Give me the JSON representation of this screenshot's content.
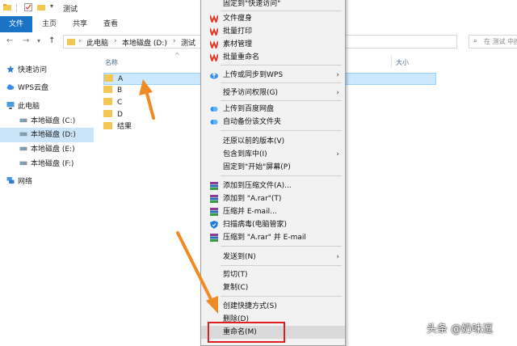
{
  "window": {
    "title": "测试"
  },
  "ribbon": {
    "tabs": [
      {
        "label": "文件"
      },
      {
        "label": "主页"
      },
      {
        "label": "共享"
      },
      {
        "label": "查看"
      }
    ]
  },
  "address": {
    "crumbs": [
      "此电脑",
      "本地磁盘 (D:)",
      "测试"
    ],
    "search_placeholder": "在 测试 中搜索"
  },
  "sidebar": {
    "items": [
      {
        "label": "快速访问",
        "icon": "star-icon"
      },
      {
        "label": "WPS云盘",
        "icon": "cloud-icon"
      },
      {
        "label": "此电脑",
        "icon": "computer-icon"
      },
      {
        "label": "本地磁盘 (C:)",
        "icon": "drive-icon"
      },
      {
        "label": "本地磁盘 (D:)",
        "icon": "drive-icon"
      },
      {
        "label": "本地磁盘 (E:)",
        "icon": "drive-icon"
      },
      {
        "label": "本地磁盘 (F:)",
        "icon": "drive-icon"
      },
      {
        "label": "网络",
        "icon": "network-icon"
      }
    ]
  },
  "filelist": {
    "columns": {
      "name": "名称",
      "size": "大小"
    },
    "rows": [
      {
        "name": "A"
      },
      {
        "name": "B"
      },
      {
        "name": "C"
      },
      {
        "name": "D"
      },
      {
        "name": "结果"
      }
    ]
  },
  "context_menu": {
    "items": [
      {
        "label": "固定到\"快速访问\""
      },
      {
        "label": "文件瘦身"
      },
      {
        "label": "批量打印"
      },
      {
        "label": "素材管理"
      },
      {
        "label": "批量重命名"
      },
      {
        "label": "上传或同步到WPS"
      },
      {
        "label": "授予访问权限(G)"
      },
      {
        "label": "上传到百度网盘"
      },
      {
        "label": "自动备份该文件夹"
      },
      {
        "label": "还原以前的版本(V)"
      },
      {
        "label": "包含到库中(I)"
      },
      {
        "label": "固定到\"开始\"屏幕(P)"
      },
      {
        "label": "添加到压缩文件(A)..."
      },
      {
        "label": "添加到 \"A.rar\"(T)"
      },
      {
        "label": "压缩并 E-mail..."
      },
      {
        "label": "扫描病毒(电脑管家)"
      },
      {
        "label": "压缩到 \"A.rar\" 并 E-mail"
      },
      {
        "label": "发送到(N)"
      },
      {
        "label": "剪切(T)"
      },
      {
        "label": "复制(C)"
      },
      {
        "label": "创建快捷方式(S)"
      },
      {
        "label": "删除(D)"
      },
      {
        "label": "重命名(M)"
      }
    ]
  },
  "watermark": "头条 @奶味逗",
  "colors": {
    "accent": "#1a73c5",
    "selection": "#cce8ff",
    "wps_red": "#e03a2f",
    "arrow": "#f08a24",
    "highlight_box": "#e02020"
  }
}
